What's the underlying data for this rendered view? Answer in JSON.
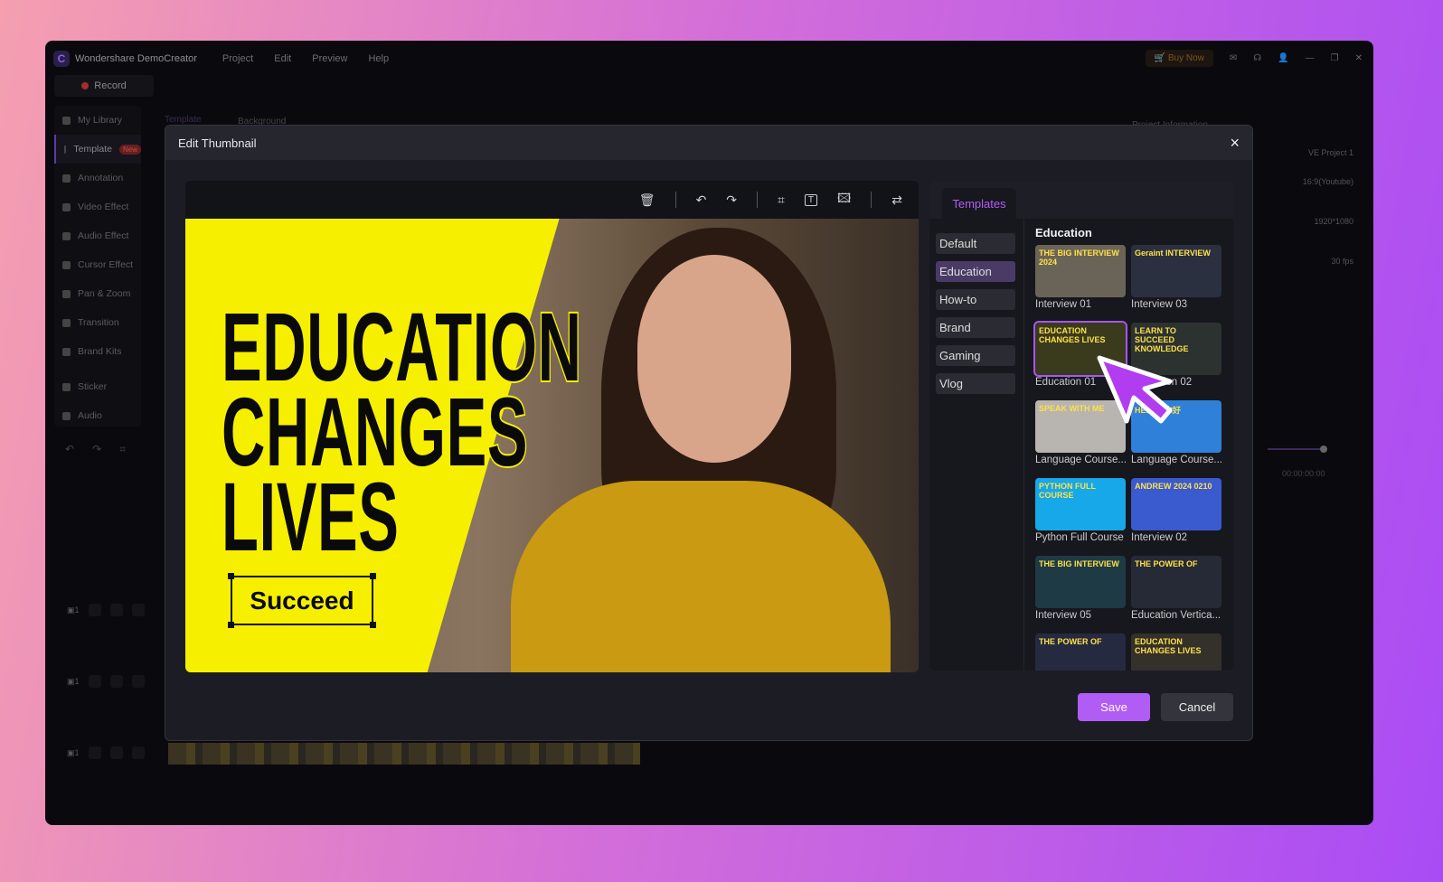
{
  "app": {
    "title": "Wondershare DemoCreator",
    "menu": [
      "Project",
      "Edit",
      "Preview",
      "Help"
    ],
    "buy_now": "Buy Now",
    "record": "Record"
  },
  "sidebar": {
    "items": [
      {
        "label": "My Library"
      },
      {
        "label": "Template",
        "badge": "New",
        "active": true
      },
      {
        "label": "Annotation"
      },
      {
        "label": "Video Effect"
      },
      {
        "label": "Audio Effect"
      },
      {
        "label": "Cursor Effect"
      },
      {
        "label": "Pan & Zoom"
      },
      {
        "label": "Transition"
      },
      {
        "label": "Brand Kits"
      },
      {
        "label": "Sticker"
      },
      {
        "label": "Audio"
      }
    ]
  },
  "background_tabs": [
    "Template",
    "Background"
  ],
  "project_info": {
    "title": "Project Information",
    "name": "VE Project 1",
    "ratio": "16:9(Youtube)",
    "resolution": "1920*1080",
    "fps": "30 fps"
  },
  "timeline": {
    "timecode": "00:00:00:00",
    "track_number": "1",
    "zoom_level": 0.78
  },
  "dialog": {
    "title": "Edit Thumbnail",
    "close": "×",
    "toolbar": [
      "delete-icon",
      "undo-icon",
      "redo-icon",
      "crop-icon",
      "text-icon",
      "image-icon",
      "swap-icon"
    ],
    "canvas": {
      "headline": [
        "EDUCATION",
        "CHANGES",
        "LIVES"
      ],
      "button_text": "Succeed",
      "accent": "#f6f000"
    },
    "panel": {
      "tab": "Templates",
      "categories": [
        {
          "label": "Default"
        },
        {
          "label": "Education",
          "active": true
        },
        {
          "label": "How-to"
        },
        {
          "label": "Brand"
        },
        {
          "label": "Gaming"
        },
        {
          "label": "Vlog"
        }
      ],
      "section_title": "Education",
      "templates": [
        {
          "label": "Interview 01",
          "thumb_text": "THE BIG INTERVIEW 2024",
          "bg": "#6a6458"
        },
        {
          "label": "Interview 03",
          "thumb_text": "Geraint INTERVIEW",
          "bg": "#2a3040"
        },
        {
          "label": "Education 01",
          "thumb_text": "EDUCATION CHANGES LIVES",
          "bg": "#3a3a1c",
          "selected": true
        },
        {
          "label": "Education 02",
          "thumb_text": "LEARN TO SUCCEED KNOWLEDGE",
          "bg": "#2c3230"
        },
        {
          "label": "Language Course...",
          "thumb_text": "SPEAK WITH ME",
          "bg": "#b8b4b0"
        },
        {
          "label": "Language Course...",
          "thumb_text": "HELLO 你好",
          "bg": "#2f80d8"
        },
        {
          "label": "Python Full Course",
          "thumb_text": "PYTHON FULL COURSE",
          "bg": "#16a8e8"
        },
        {
          "label": "Interview 02",
          "thumb_text": "ANDREW 2024 0210",
          "bg": "#3a5ad0"
        },
        {
          "label": "Interview 05",
          "thumb_text": "THE BIG INTERVIEW",
          "bg": "#1e3a44"
        },
        {
          "label": "Education Vertica...",
          "thumb_text": "THE POWER OF",
          "bg": "#262a36"
        },
        {
          "label": "",
          "thumb_text": "THE POWER OF",
          "bg": "#262a40"
        },
        {
          "label": "",
          "thumb_text": "EDUCATION CHANGES LIVES",
          "bg": "#34302a"
        }
      ]
    },
    "save": "Save",
    "cancel": "Cancel"
  },
  "colors": {
    "accent": "#b25cf6",
    "background_gradient": [
      "#f59fb0",
      "#a94cf5"
    ]
  }
}
